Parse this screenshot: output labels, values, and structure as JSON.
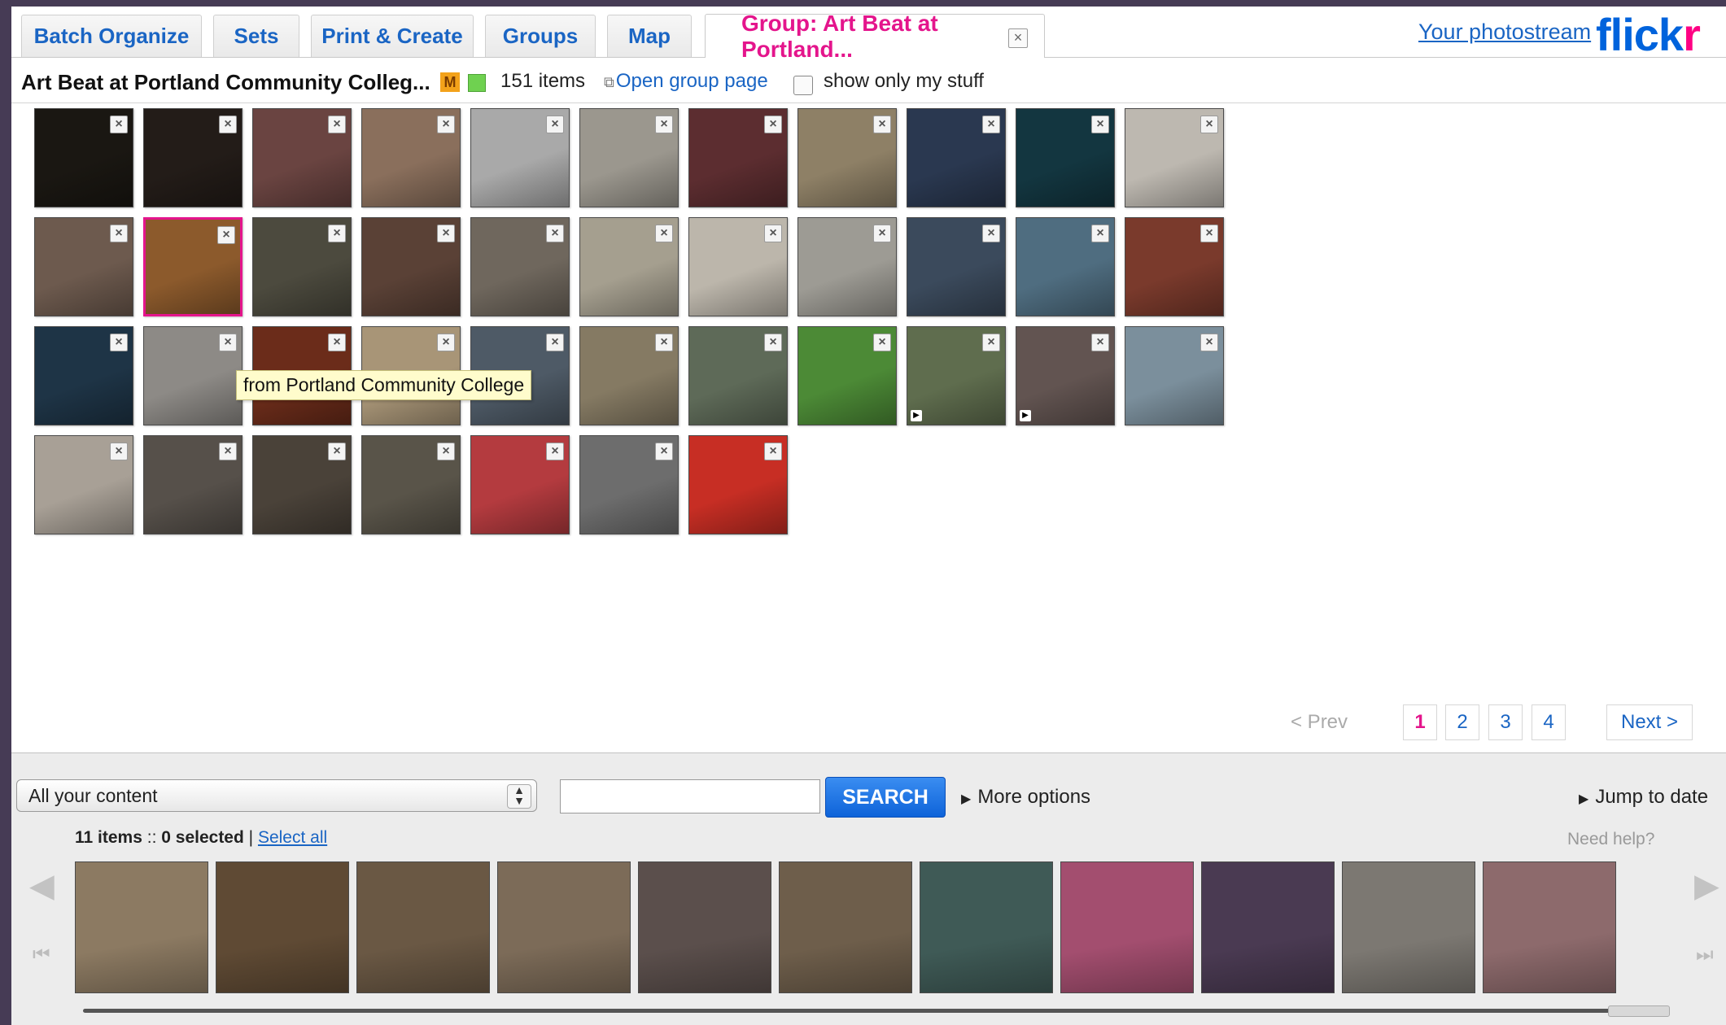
{
  "tabs": [
    {
      "label": "Batch Organize"
    },
    {
      "label": "Sets"
    },
    {
      "label": "Print & Create"
    },
    {
      "label": "Groups"
    },
    {
      "label": "Map"
    },
    {
      "label": "Group: Art Beat at Portland..."
    }
  ],
  "header": {
    "photostream_link": "Your photostream",
    "logo_part1": "flick",
    "logo_part2": "r"
  },
  "group": {
    "title": "Art Beat at Portland Community Colleg...",
    "moderator_badge": "M",
    "item_count": "151 items",
    "open_group_page": "Open group page",
    "show_only_my_stuff": "show only my stuff"
  },
  "tooltip": "from Portland Community College",
  "pagination": {
    "prev": "< Prev",
    "pages": [
      "1",
      "2",
      "3",
      "4"
    ],
    "current_page": "1",
    "next": "Next >"
  },
  "tray": {
    "content_select_value": "All your content",
    "search_placeholder": "",
    "search_button": "SEARCH",
    "more_options": "More options",
    "jump_to_date": "Jump to date",
    "items_count": "11 items",
    "separator": " :: ",
    "selected_count": "0 selected",
    "pipe": " | ",
    "select_all": "Select all",
    "need_help": "Need help?"
  },
  "grid_photos": [
    {
      "bg": "#1a1712",
      "selected": false,
      "video": false
    },
    {
      "bg": "#231c18",
      "selected": false,
      "video": false
    },
    {
      "bg": "#6a4441",
      "selected": false,
      "video": false
    },
    {
      "bg": "#8a6f5c",
      "selected": false,
      "video": false
    },
    {
      "bg": "#a9a9a9",
      "selected": false,
      "video": false
    },
    {
      "bg": "#9b978e",
      "selected": false,
      "video": false
    },
    {
      "bg": "#5c2d30",
      "selected": false,
      "video": false
    },
    {
      "bg": "#8e8066",
      "selected": false,
      "video": false
    },
    {
      "bg": "#2a3850",
      "selected": false,
      "video": false
    },
    {
      "bg": "#133640",
      "selected": false,
      "video": false
    },
    {
      "bg": "#bdb8b0",
      "selected": false,
      "video": false
    },
    {
      "bg": "#6d5a4e",
      "selected": false,
      "video": false
    },
    {
      "bg": "#8c5a2c",
      "selected": true,
      "video": false
    },
    {
      "bg": "#4c4a3e",
      "selected": false,
      "video": false
    },
    {
      "bg": "#5a4136",
      "selected": false,
      "video": false
    },
    {
      "bg": "#6f675d",
      "selected": false,
      "video": false
    },
    {
      "bg": "#a59f8f",
      "selected": false,
      "video": false
    },
    {
      "bg": "#bcb6ab",
      "selected": false,
      "video": false
    },
    {
      "bg": "#9d9b94",
      "selected": false,
      "video": false
    },
    {
      "bg": "#3b4a5c",
      "selected": false,
      "video": false
    },
    {
      "bg": "#4f6d80",
      "selected": false,
      "video": false
    },
    {
      "bg": "#7a3a2c",
      "selected": false,
      "video": false
    },
    {
      "bg": "#1e3446",
      "selected": false,
      "video": false
    },
    {
      "bg": "#8d8a86",
      "selected": false,
      "video": false
    },
    {
      "bg": "#6b2c1a",
      "selected": false,
      "video": false
    },
    {
      "bg": "#a89577",
      "selected": false,
      "video": false
    },
    {
      "bg": "#4e5a66",
      "selected": false,
      "video": false
    },
    {
      "bg": "#857a63",
      "selected": false,
      "video": false
    },
    {
      "bg": "#5e6a58",
      "selected": false,
      "video": false
    },
    {
      "bg": "#4c8a36",
      "selected": false,
      "video": false
    },
    {
      "bg": "#5f6d4e",
      "selected": false,
      "video": true
    },
    {
      "bg": "#625451",
      "selected": false,
      "video": true
    },
    {
      "bg": "#7b8f9c",
      "selected": false,
      "video": false
    },
    {
      "bg": "#a8a096",
      "selected": false,
      "video": false
    },
    {
      "bg": "#56504a",
      "selected": false,
      "video": false
    },
    {
      "bg": "#4a4239",
      "selected": false,
      "video": false
    },
    {
      "bg": "#595449",
      "selected": false,
      "video": false
    },
    {
      "bg": "#b43b3f",
      "selected": false,
      "video": false
    },
    {
      "bg": "#6d6d6d",
      "selected": false,
      "video": false
    },
    {
      "bg": "#c72e24",
      "selected": false,
      "video": false
    }
  ],
  "filmstrip_photos": [
    {
      "bg": "#8c7a62"
    },
    {
      "bg": "#5f4a34"
    },
    {
      "bg": "#6a5844"
    },
    {
      "bg": "#7c6b58"
    },
    {
      "bg": "#5b4f4c"
    },
    {
      "bg": "#6e5e4b"
    },
    {
      "bg": "#3f5a56"
    },
    {
      "bg": "#a34e6f"
    },
    {
      "bg": "#4a3a52"
    },
    {
      "bg": "#7c7872"
    },
    {
      "bg": "#8d6a6c"
    }
  ]
}
